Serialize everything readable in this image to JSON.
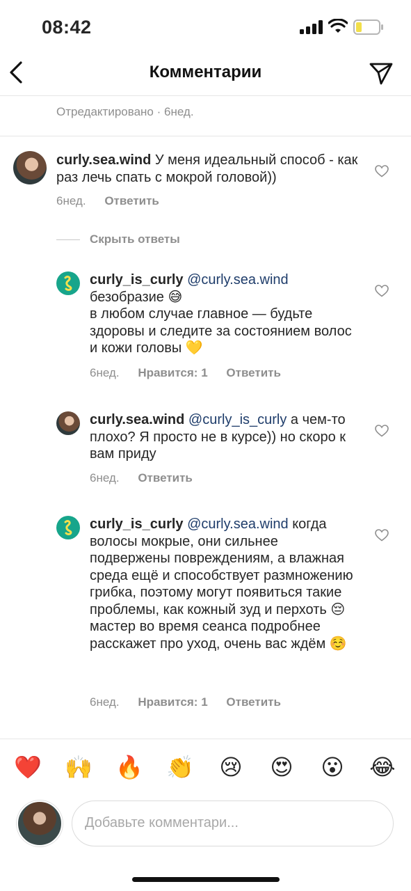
{
  "status": {
    "time": "08:42"
  },
  "nav": {
    "title": "Комментарии"
  },
  "edited": "Отредактировано · 6нед.",
  "main_comment": {
    "username": "curly.sea.wind",
    "text": " У меня идеальный способ - как раз лечь спать с мокрой головой))",
    "time": "6нед.",
    "reply": "Ответить"
  },
  "hide_replies": "Скрыть ответы",
  "replies": [
    {
      "username": "curly_is_curly",
      "mention": "@curly.sea.wind",
      "text": " безобразие 😅\nв любом случае главное — будьте здоровы и следите за состоянием волос и кожи головы 💛",
      "time": "6нед.",
      "likes": "Нравится: 1",
      "reply": "Ответить"
    },
    {
      "username": "curly.sea.wind",
      "mention": "@curly_is_curly",
      "text": " а чем-то плохо? Я просто не в курсе)) но скоро к вам приду",
      "time": "6нед.",
      "reply": "Ответить"
    },
    {
      "username": "curly_is_curly",
      "mention": "@curly.sea.wind",
      "text": " когда волосы мокрые, они сильнее подвержены повреждениям, а влажная среда ещё и способствует размножению грибка, поэтому могут появиться такие проблемы, как кожный зуд и перхоть 😔\nмастер во время сеанса подробнее расскажет про уход, очень вас ждём ☺️",
      "time": "6нед.",
      "likes": "Нравится: 1",
      "reply": "Ответить"
    }
  ],
  "reactions": [
    "❤️",
    "🙌",
    "🔥",
    "👏",
    "😢",
    "😍",
    "😮",
    "😂"
  ],
  "input": {
    "placeholder": "Добавьте комментари..."
  }
}
